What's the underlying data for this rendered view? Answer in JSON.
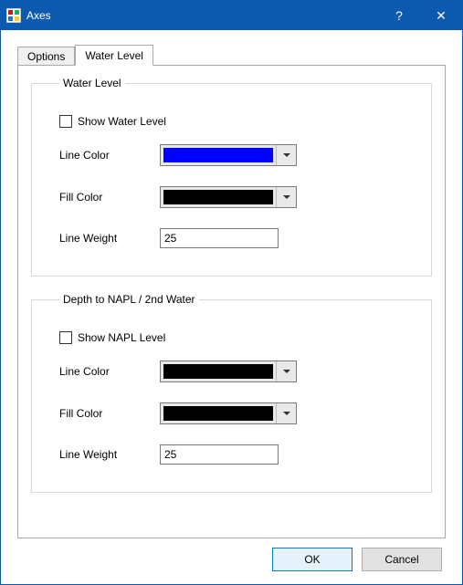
{
  "window": {
    "title": "Axes",
    "help_glyph": "?",
    "close_glyph": "✕"
  },
  "tabs": {
    "options": "Options",
    "water_level": "Water Level"
  },
  "group_water": {
    "legend": "Water Level",
    "show_label": "Show Water Level",
    "line_color_label": "Line Color",
    "fill_color_label": "Fill Color",
    "line_weight_label": "Line Weight",
    "line_color": "#0000ff",
    "fill_color": "#000000",
    "line_weight": "25"
  },
  "group_napl": {
    "legend": "Depth to NAPL / 2nd Water",
    "show_label": "Show NAPL Level",
    "line_color_label": "Line Color",
    "fill_color_label": "Fill Color",
    "line_weight_label": "Line Weight",
    "line_color": "#000000",
    "fill_color": "#000000",
    "line_weight": "25"
  },
  "buttons": {
    "ok": "OK",
    "cancel": "Cancel"
  }
}
